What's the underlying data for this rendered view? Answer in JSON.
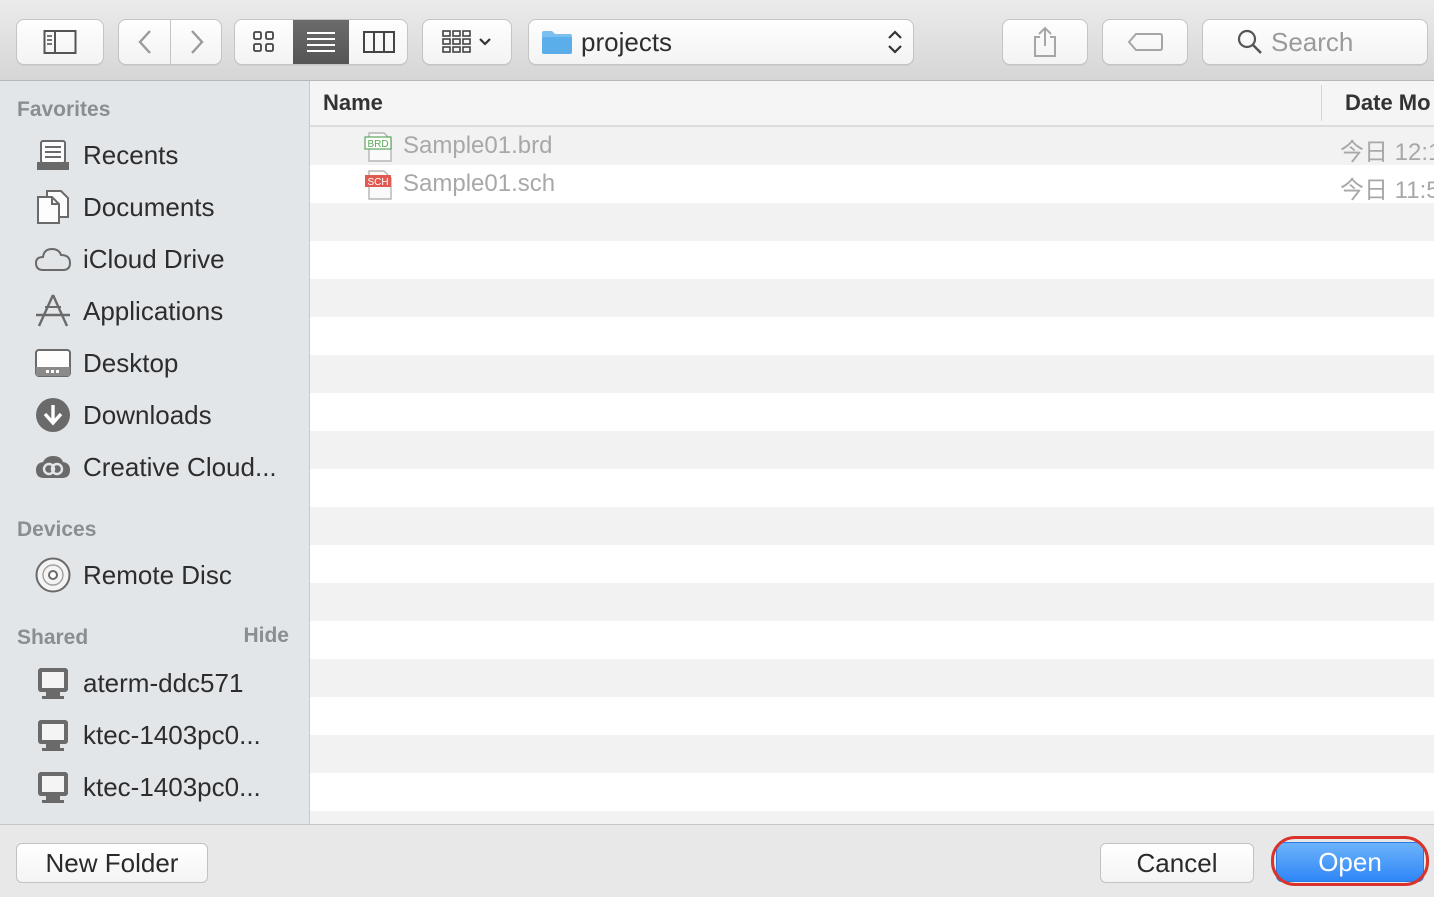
{
  "toolbar": {
    "path_folder": "projects",
    "search_placeholder": "Search"
  },
  "sidebar": {
    "favorites_heading": "Favorites",
    "favorites": [
      {
        "label": "Recents",
        "icon": "recents-icon"
      },
      {
        "label": "Documents",
        "icon": "documents-icon"
      },
      {
        "label": "iCloud Drive",
        "icon": "icloud-icon"
      },
      {
        "label": "Applications",
        "icon": "applications-icon"
      },
      {
        "label": "Desktop",
        "icon": "desktop-icon"
      },
      {
        "label": "Downloads",
        "icon": "downloads-icon"
      },
      {
        "label": "Creative Cloud...",
        "icon": "creative-cloud-icon"
      }
    ],
    "devices_heading": "Devices",
    "devices": [
      {
        "label": "Remote Disc",
        "icon": "disc-icon"
      }
    ],
    "shared_heading": "Shared",
    "shared_hide": "Hide",
    "shared": [
      {
        "label": "aterm-ddc571",
        "icon": "computer-icon"
      },
      {
        "label": "ktec-1403pc0...",
        "icon": "computer-icon"
      },
      {
        "label": "ktec-1403pc0...",
        "icon": "computer-icon"
      }
    ]
  },
  "list": {
    "columns": {
      "name": "Name",
      "date": "Date Mo"
    },
    "files": [
      {
        "name": "Sample01.brd",
        "date": "今日 12:1",
        "badge": "BRD",
        "badge_color": "#5aa65a"
      },
      {
        "name": "Sample01.sch",
        "date": "今日 11:5",
        "badge": "SCH",
        "badge_color": "#d0413a"
      }
    ]
  },
  "buttons": {
    "new_folder": "New Folder",
    "cancel": "Cancel",
    "open": "Open"
  },
  "colors": {
    "accent": "#2f86f7",
    "highlight": "#d9332b"
  }
}
